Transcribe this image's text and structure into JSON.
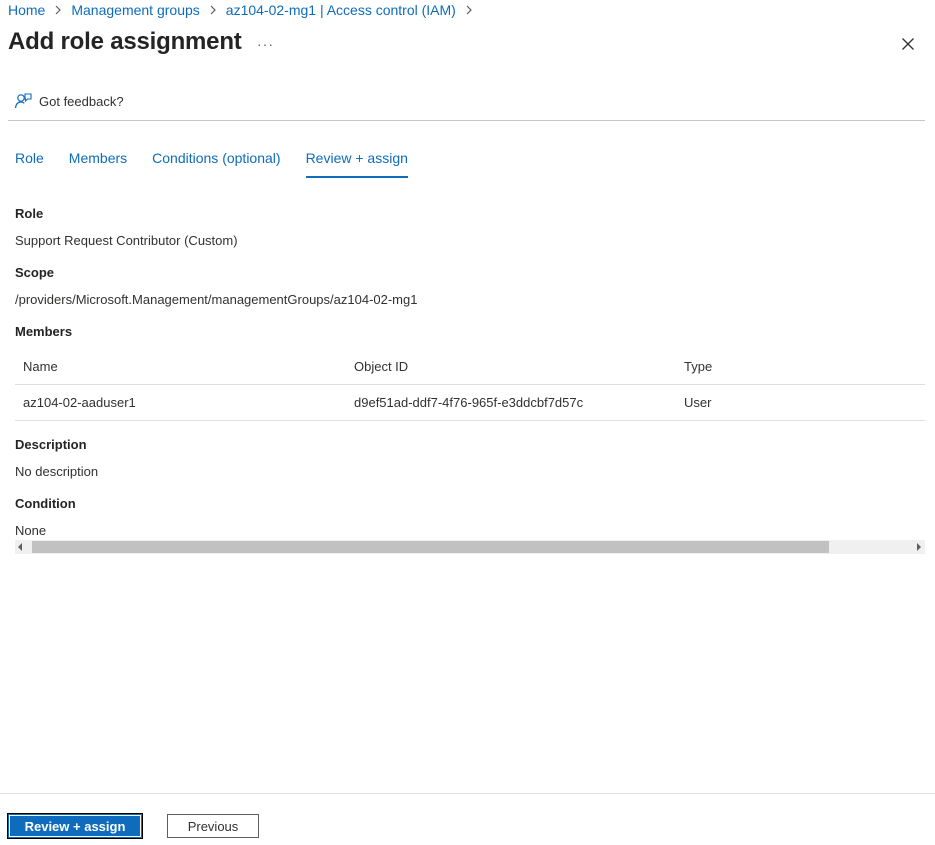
{
  "breadcrumb": {
    "items": [
      "Home",
      "Management groups",
      "az104-02-mg1 | Access control (IAM)"
    ]
  },
  "header": {
    "title": "Add role assignment",
    "more": "···"
  },
  "feedback": {
    "label": "Got feedback?"
  },
  "tabs": [
    {
      "label": "Role"
    },
    {
      "label": "Members"
    },
    {
      "label": "Conditions (optional)"
    },
    {
      "label": "Review + assign"
    }
  ],
  "active_tab": "Review + assign",
  "review": {
    "role_label": "Role",
    "role_value": "Support Request Contributor (Custom)",
    "scope_label": "Scope",
    "scope_value": "/providers/Microsoft.Management/managementGroups/az104-02-mg1",
    "members_label": "Members",
    "members_table": {
      "columns": [
        "Name",
        "Object ID",
        "Type"
      ],
      "rows": [
        [
          "az104-02-aaduser1",
          "d9ef51ad-ddf7-4f76-965f-e3ddcbf7d57c",
          "User"
        ]
      ]
    },
    "description_label": "Description",
    "description_value": "No description",
    "condition_label": "Condition",
    "condition_value": "None"
  },
  "footer": {
    "primary_label": "Review + assign",
    "secondary_label": "Previous"
  },
  "colors": {
    "accent": "#0f6cbd",
    "text": "#323130"
  }
}
